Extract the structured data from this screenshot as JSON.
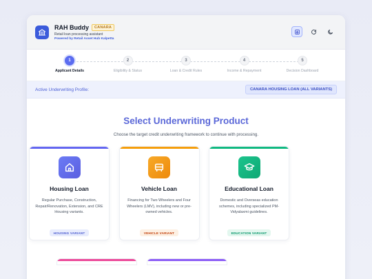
{
  "header": {
    "title": "RAH Buddy",
    "badge": "CANARA",
    "subtitle": "Retail loan processing assistant",
    "powered_by": "Powered by Retail Asset Hub Kalpetta"
  },
  "header_actions": [
    {
      "icon": "home-icon"
    },
    {
      "icon": "refresh-icon"
    },
    {
      "icon": "moon-icon"
    }
  ],
  "steps": [
    {
      "number": "1",
      "label": "Applicant Details",
      "active": true
    },
    {
      "number": "2",
      "label": "Eligibility & Status",
      "active": false
    },
    {
      "number": "3",
      "label": "Loan & Credit Rules",
      "active": false
    },
    {
      "number": "4",
      "label": "Income & Repayment",
      "active": false
    },
    {
      "number": "5",
      "label": "Decision Dashboard",
      "active": false
    }
  ],
  "profile": {
    "label": "Active Underwriting Profile:",
    "value": "CANARA HOUSING LOAN (ALL VARIANTS)"
  },
  "main": {
    "title": "Select Underwriting Product",
    "subtitle": "Choose the target credit underwriting framework to continue with processing."
  },
  "products": [
    {
      "title": "Housing Loan",
      "description": "Regular Purchase, Construction, Repair/Renovation, Extension, and CRE Housing variants.",
      "tag": "HOUSING VARIANT",
      "icon": "home-icon",
      "accent": "#6366f1",
      "tag_color": "#4f5fd0",
      "tag_bg": "#e8ecfd"
    },
    {
      "title": "Vehicle Loan",
      "description": "Financing for Two Wheelers and Four Wheelers (LMV), including new or pre-owned vehicles.",
      "tag": "VEHICLE VARIANT",
      "icon": "car-icon",
      "accent": "#f59e0b",
      "tag_color": "#c2410c",
      "tag_bg": "#fdf0e3"
    },
    {
      "title": "Educational Loan",
      "description": "Domestic and Overseas education schemes, including specialized PM-Vidyalaxmi guidelines.",
      "tag": "EDUCATION VARIANT",
      "icon": "graduation-cap-icon",
      "accent": "#10b981",
      "tag_color": "#059669",
      "tag_bg": "#e3f7ef"
    }
  ],
  "colors": {
    "primary": "#5b6cf0",
    "peek_card_1": "#ec4899",
    "peek_card_2": "#8b5cf6"
  }
}
